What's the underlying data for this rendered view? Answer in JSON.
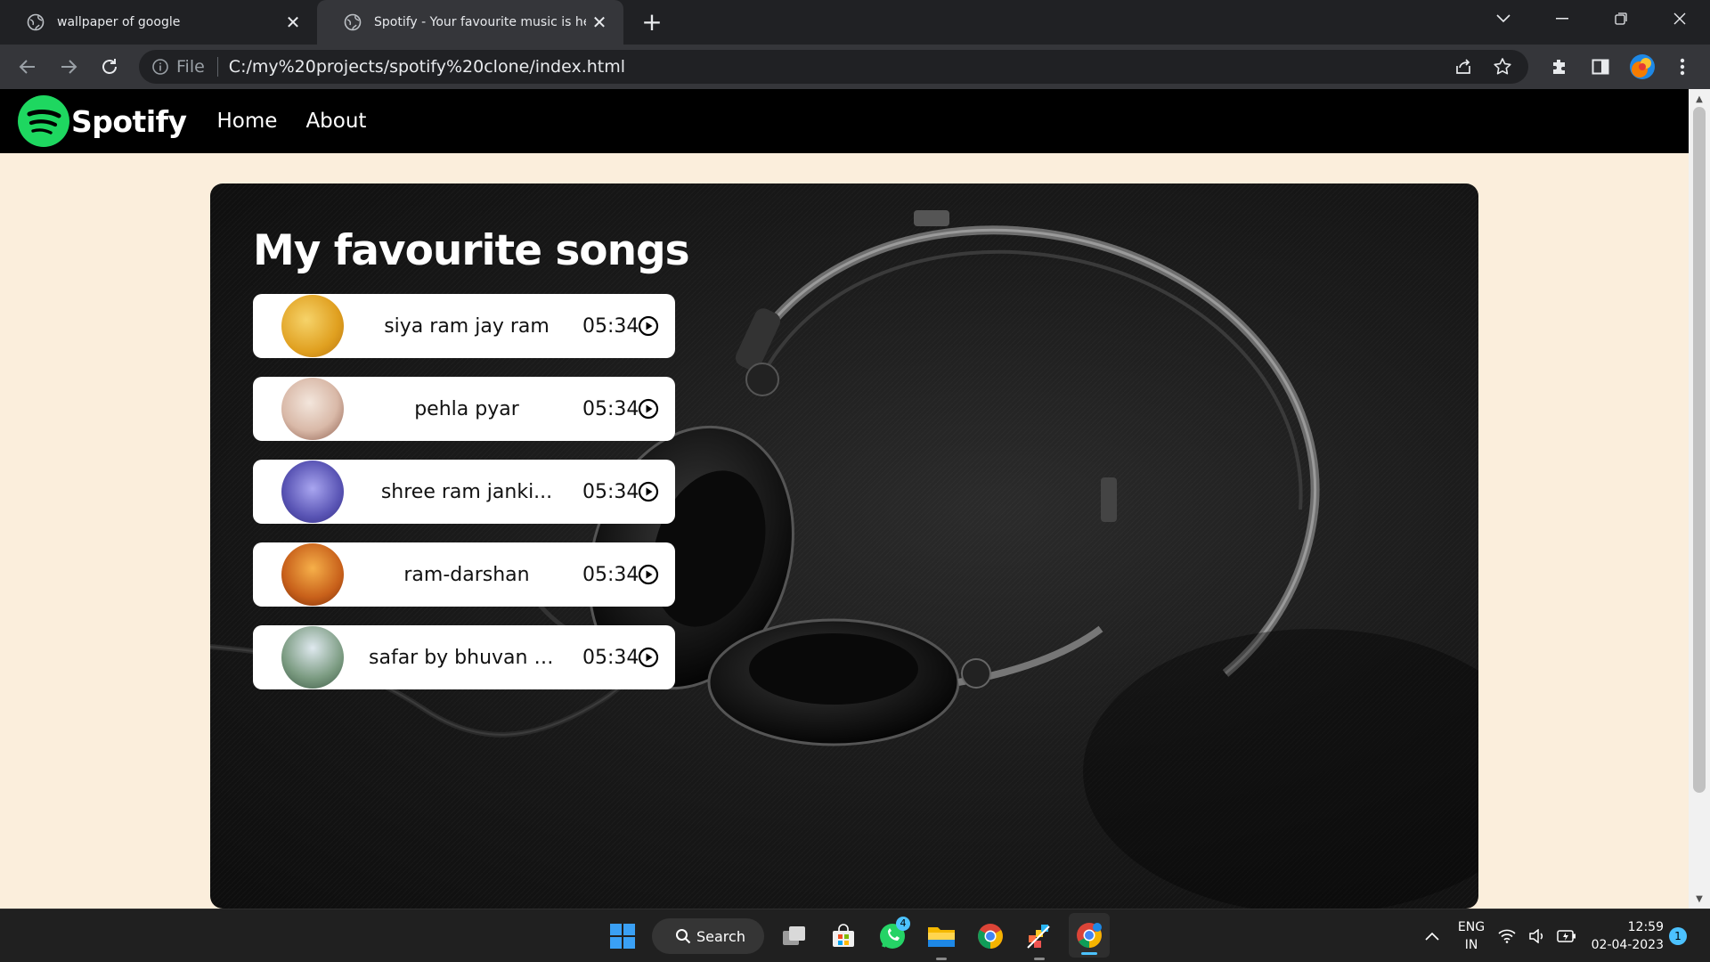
{
  "browser": {
    "tabs": [
      {
        "title": "wallpaper of google",
        "active": false
      },
      {
        "title": "Spotify - Your favourite music is here",
        "active": true
      }
    ],
    "address": {
      "scheme_label": "File",
      "url": "C:/my%20projects/spotify%20clone/index.html"
    }
  },
  "site": {
    "brand": "Spotify",
    "nav": [
      {
        "label": "Home"
      },
      {
        "label": "About"
      }
    ],
    "heading": "My favourite songs",
    "songs": [
      {
        "name": "siya ram jay ram",
        "duration": "05:34",
        "thumb_color": "#e0a020"
      },
      {
        "name": "pehla pyar",
        "duration": "05:34",
        "thumb_color": "#d9b9a8"
      },
      {
        "name": "shree ram janki...",
        "duration": "05:34",
        "thumb_color": "#5a55b5"
      },
      {
        "name": "ram-darshan",
        "duration": "05:34",
        "thumb_color": "#c8601a"
      },
      {
        "name": "safar by bhuvan bam",
        "duration": "05:34",
        "thumb_color": "#7a9a80"
      }
    ],
    "colors": {
      "brand_green": "#1ed760",
      "page_bg": "#fbeedc",
      "nav_bg": "#000000"
    }
  },
  "taskbar": {
    "search_label": "Search",
    "whatsapp_badge": "4",
    "lang_line1": "ENG",
    "lang_line2": "IN",
    "time": "12:59",
    "date": "02-04-2023",
    "notification_count": "1"
  }
}
